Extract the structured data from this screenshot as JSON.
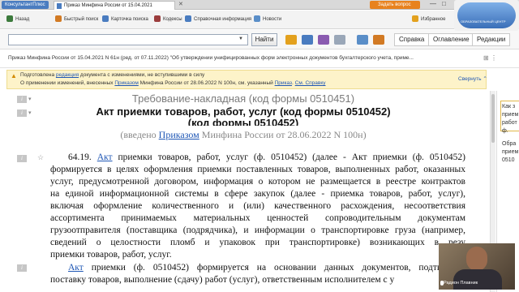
{
  "titlebar": {
    "app_name": "КонсультантПлюс",
    "tab_title": "Приказ Минфина России от 15.04.2021",
    "ask_button": "Задать вопрос",
    "minimize": "—",
    "maximize": "□",
    "close": "✕"
  },
  "toolbar": {
    "items": [
      {
        "label": "Назад",
        "icon": "back-arrow-icon",
        "color": "#3c7a3c"
      },
      {
        "label": "Быстрый поиск",
        "icon": "quick-search-icon",
        "color": "#d27a24"
      },
      {
        "label": "Карточка поиска",
        "icon": "search-card-icon",
        "color": "#4a7cc0"
      },
      {
        "label": "Кодексы",
        "icon": "codes-icon",
        "color": "#9b3d3d"
      },
      {
        "label": "Справочная информация",
        "icon": "reference-icon",
        "color": "#4a7cc0"
      },
      {
        "label": "Новости",
        "icon": "news-icon",
        "color": "#5a8ec8"
      },
      {
        "label": "Избранное",
        "icon": "star-icon",
        "color": "#e3a11e"
      }
    ]
  },
  "search": {
    "value": "",
    "find_button": "Найти"
  },
  "right_tabs": [
    "Справка",
    "Оглавление",
    "Редакции"
  ],
  "doc_header": {
    "text": "Приказ Минфина России от 15.04.2021 N 61н (ред. от 07.11.2022) \"Об утверждении унифицированных форм электронных документов бухгалтерского учета, приме..."
  },
  "warning": {
    "line1_a": "Подготовлена ",
    "line1_link": "редакция",
    "line1_b": " документа с изменениями, не вступившими в силу",
    "line2_a": "О применении изменений, внесенных ",
    "line2_link": "Приказом",
    "line2_b": " Минфина России от 28.06.2022 N 100н, см. указанный ",
    "line2_link2": "Приказ",
    "line2_c": ". ",
    "line2_link3": "См. Справку",
    "collapse": "Свернуть"
  },
  "document": {
    "heading_grey": "Требование-накладная (код формы 0510451)",
    "heading_bold": "Акт приемки товаров, работ, услуг (код формы 0510452)",
    "heading_bold_2": "(код формы 0510452)",
    "intro_a": "(введено ",
    "intro_link": "Приказом",
    "intro_b": " Минфина России от 28.06.2022 N 100н)",
    "para1_lines": [
      {
        "prefix": "64.19. ",
        "link": "Акт",
        "text": " приемки товаров, работ, услуг (ф. 0510452) (далее - Акт приемки (ф. 0510452)"
      },
      {
        "prefix": "",
        "link": "",
        "text": "формируется в целях оформления приемки поставленных товаров, выполненных работ, оказанных"
      },
      {
        "prefix": "",
        "link": "",
        "text": "услуг, предусмотренной договором, информация о котором не размещается в реестре контрактов"
      },
      {
        "prefix": "",
        "link": "",
        "text": "на единой информационной системы в сфере закупок (далее - приемка товаров, работ, услуг),"
      },
      {
        "prefix": "",
        "link": "",
        "text": "включая оформление количественного и (или) качественного расхождения, несоответствия"
      },
      {
        "prefix": "",
        "link": "",
        "text": "ассортимента принимаемых материальных ценностей сопроводительным документам"
      },
      {
        "prefix": "",
        "link": "",
        "text": "грузоотправителя (поставщика (подрядчика), и информации о транспортировке груза (например,"
      },
      {
        "prefix": "",
        "link": "",
        "text": "сведений о целостности пломб и упаковок при транспортировке) возникающих в резу"
      },
      {
        "prefix": "",
        "link": "",
        "text": "приемки товаров, работ, услуг."
      }
    ],
    "para2_lines": [
      {
        "prefix": "",
        "link": "Акт",
        "text": " приемки (ф. 0510452) формируется на основании данных документов, подтвержда"
      },
      {
        "prefix": "",
        "link": "",
        "text": "поставку товаров, выполнение (сдачу) работ (услуг), ответственным исполнителем с у"
      }
    ]
  },
  "right_panel": {
    "lines": [
      "Как з",
      "прием",
      "работ",
      "ф.",
      "Обра",
      "прием",
      "0510"
    ]
  },
  "overlay": {
    "logo_caption": "ОБРАЗОВАТЕЛЬНЫЙ ЦЕНТР",
    "participant_name": "Радион Плавник"
  },
  "colors": {
    "link": "#1f57b5",
    "warning_bg": "#fdf3c9",
    "accent_orange": "#e8821e"
  }
}
